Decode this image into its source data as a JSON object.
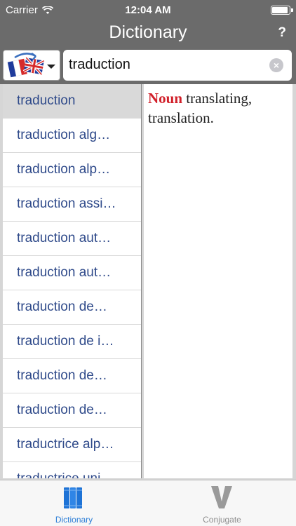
{
  "status_bar": {
    "carrier": "Carrier",
    "time": "12:04 AM",
    "battery_level": 0.85
  },
  "nav": {
    "title": "Dictionary",
    "help_label": "?"
  },
  "language_selector": {
    "icon": "france-uk-flags-icon"
  },
  "search": {
    "value": "traduction"
  },
  "results": [
    {
      "label": "traduction",
      "selected": true
    },
    {
      "label": "traduction alg…"
    },
    {
      "label": "traduction alp…"
    },
    {
      "label": "traduction assi…"
    },
    {
      "label": "traduction aut…"
    },
    {
      "label": "traduction aut…"
    },
    {
      "label": "traduction de…"
    },
    {
      "label": "traduction de i…"
    },
    {
      "label": "traduction de…"
    },
    {
      "label": "traduction de…"
    },
    {
      "label": "traductrice alp…"
    },
    {
      "label": "traductrice uni…"
    }
  ],
  "definition": {
    "part_of_speech": "Noun",
    "text": " translating, translation."
  },
  "tabs": [
    {
      "label": "Dictionary",
      "icon": "books-icon",
      "active": true
    },
    {
      "label": "Conjugate",
      "icon": "conjugate-v-icon",
      "active": false
    }
  ],
  "colors": {
    "accent": "#2e7fd7",
    "bar_gray": "#6b6b6b",
    "list_text": "#2f4a8a",
    "pos_red": "#d1202a"
  }
}
